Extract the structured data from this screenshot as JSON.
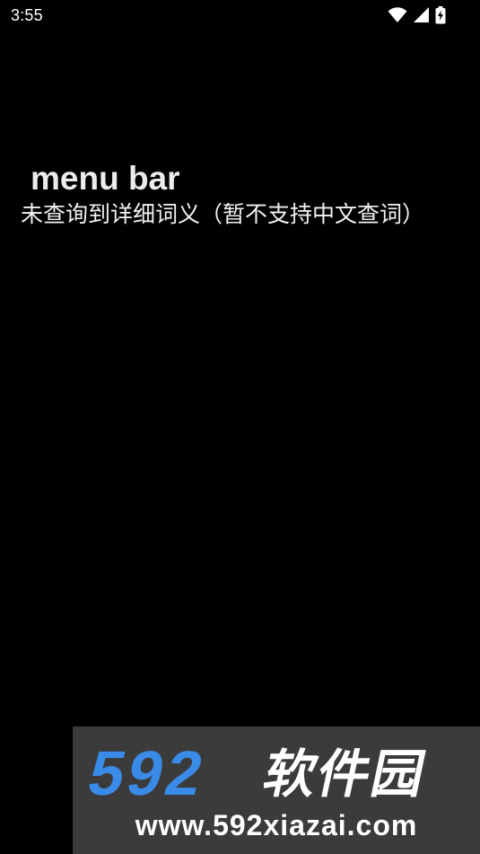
{
  "status_bar": {
    "time": "3:55",
    "icons": [
      "wifi-icon",
      "cellular-signal-icon",
      "battery-charging-icon"
    ]
  },
  "main": {
    "word": "menu bar",
    "message": "未查询到详细词义（暂不支持中文查词）"
  },
  "watermark": {
    "logo_number": "592",
    "logo_text": "软件园",
    "url": "www.592xiazai.com",
    "colors": {
      "number": "#3a8be8",
      "text": "#ffffff",
      "background": "#3b3b3b"
    }
  }
}
